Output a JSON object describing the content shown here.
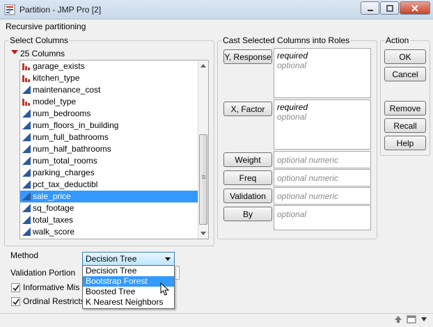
{
  "window": {
    "title": "Partition - JMP Pro [2]",
    "minimize_icon": "minimize-icon",
    "maximize_icon": "maximize-icon",
    "close_icon": "close-icon"
  },
  "header": {
    "label": "Recursive partitioning"
  },
  "select_columns": {
    "title": "Select Columns",
    "count_label": "25 Columns",
    "items": [
      {
        "name": "garage_exists",
        "type": "nominal",
        "selected": false
      },
      {
        "name": "kitchen_type",
        "type": "nominal",
        "selected": false
      },
      {
        "name": "maintenance_cost",
        "type": "continuous",
        "selected": false
      },
      {
        "name": "model_type",
        "type": "nominal",
        "selected": false
      },
      {
        "name": "num_bedrooms",
        "type": "continuous",
        "selected": false
      },
      {
        "name": "num_floors_in_building",
        "type": "continuous",
        "selected": false
      },
      {
        "name": "num_full_bathrooms",
        "type": "continuous",
        "selected": false
      },
      {
        "name": "num_half_bathrooms",
        "type": "continuous",
        "selected": false
      },
      {
        "name": "num_total_rooms",
        "type": "continuous",
        "selected": false
      },
      {
        "name": "parking_charges",
        "type": "continuous",
        "selected": false
      },
      {
        "name": "pct_tax_deductibl",
        "type": "continuous",
        "selected": false
      },
      {
        "name": "sale_price",
        "type": "continuous",
        "selected": true
      },
      {
        "name": "sq_footage",
        "type": "continuous",
        "selected": false
      },
      {
        "name": "total_taxes",
        "type": "continuous",
        "selected": false
      },
      {
        "name": "walk_score",
        "type": "continuous",
        "selected": false
      }
    ]
  },
  "cast": {
    "title": "Cast Selected Columns into Roles",
    "roles": [
      {
        "button": "Y, Response",
        "required": "required",
        "optional": "optional"
      },
      {
        "button": "X, Factor",
        "required": "required",
        "optional": "optional"
      },
      {
        "button": "Weight",
        "optional": "optional numeric"
      },
      {
        "button": "Freq",
        "optional": "optional numeric"
      },
      {
        "button": "Validation",
        "optional": "optional numeric"
      },
      {
        "button": "By",
        "optional": "optional"
      }
    ]
  },
  "action": {
    "title": "Action",
    "buttons": [
      "OK",
      "Cancel",
      "Remove",
      "Recall",
      "Help"
    ]
  },
  "method": {
    "label": "Method",
    "selected": "Decision Tree",
    "options": [
      "Decision Tree",
      "Bootstrap Forest",
      "Boosted Tree",
      "K Nearest Neighbors"
    ],
    "hover_index": 1
  },
  "validation_portion": {
    "label": "Validation Portion"
  },
  "checkboxes": [
    {
      "label": "Informative Mis",
      "checked": true
    },
    {
      "label": "Ordinal Restricts",
      "checked": true
    }
  ],
  "colors": {
    "selection": "#3399ff",
    "nominal_icon": "#c0392b",
    "continuous_icon": "#2c5aa0"
  }
}
